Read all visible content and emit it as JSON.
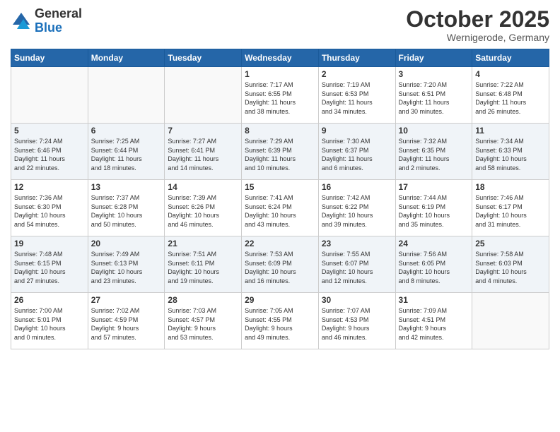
{
  "header": {
    "logo_general": "General",
    "logo_blue": "Blue",
    "month": "October 2025",
    "location": "Wernigerode, Germany"
  },
  "weekdays": [
    "Sunday",
    "Monday",
    "Tuesday",
    "Wednesday",
    "Thursday",
    "Friday",
    "Saturday"
  ],
  "weeks": [
    [
      {
        "day": "",
        "info": ""
      },
      {
        "day": "",
        "info": ""
      },
      {
        "day": "",
        "info": ""
      },
      {
        "day": "1",
        "info": "Sunrise: 7:17 AM\nSunset: 6:55 PM\nDaylight: 11 hours\nand 38 minutes."
      },
      {
        "day": "2",
        "info": "Sunrise: 7:19 AM\nSunset: 6:53 PM\nDaylight: 11 hours\nand 34 minutes."
      },
      {
        "day": "3",
        "info": "Sunrise: 7:20 AM\nSunset: 6:51 PM\nDaylight: 11 hours\nand 30 minutes."
      },
      {
        "day": "4",
        "info": "Sunrise: 7:22 AM\nSunset: 6:48 PM\nDaylight: 11 hours\nand 26 minutes."
      }
    ],
    [
      {
        "day": "5",
        "info": "Sunrise: 7:24 AM\nSunset: 6:46 PM\nDaylight: 11 hours\nand 22 minutes."
      },
      {
        "day": "6",
        "info": "Sunrise: 7:25 AM\nSunset: 6:44 PM\nDaylight: 11 hours\nand 18 minutes."
      },
      {
        "day": "7",
        "info": "Sunrise: 7:27 AM\nSunset: 6:41 PM\nDaylight: 11 hours\nand 14 minutes."
      },
      {
        "day": "8",
        "info": "Sunrise: 7:29 AM\nSunset: 6:39 PM\nDaylight: 11 hours\nand 10 minutes."
      },
      {
        "day": "9",
        "info": "Sunrise: 7:30 AM\nSunset: 6:37 PM\nDaylight: 11 hours\nand 6 minutes."
      },
      {
        "day": "10",
        "info": "Sunrise: 7:32 AM\nSunset: 6:35 PM\nDaylight: 11 hours\nand 2 minutes."
      },
      {
        "day": "11",
        "info": "Sunrise: 7:34 AM\nSunset: 6:33 PM\nDaylight: 10 hours\nand 58 minutes."
      }
    ],
    [
      {
        "day": "12",
        "info": "Sunrise: 7:36 AM\nSunset: 6:30 PM\nDaylight: 10 hours\nand 54 minutes."
      },
      {
        "day": "13",
        "info": "Sunrise: 7:37 AM\nSunset: 6:28 PM\nDaylight: 10 hours\nand 50 minutes."
      },
      {
        "day": "14",
        "info": "Sunrise: 7:39 AM\nSunset: 6:26 PM\nDaylight: 10 hours\nand 46 minutes."
      },
      {
        "day": "15",
        "info": "Sunrise: 7:41 AM\nSunset: 6:24 PM\nDaylight: 10 hours\nand 43 minutes."
      },
      {
        "day": "16",
        "info": "Sunrise: 7:42 AM\nSunset: 6:22 PM\nDaylight: 10 hours\nand 39 minutes."
      },
      {
        "day": "17",
        "info": "Sunrise: 7:44 AM\nSunset: 6:19 PM\nDaylight: 10 hours\nand 35 minutes."
      },
      {
        "day": "18",
        "info": "Sunrise: 7:46 AM\nSunset: 6:17 PM\nDaylight: 10 hours\nand 31 minutes."
      }
    ],
    [
      {
        "day": "19",
        "info": "Sunrise: 7:48 AM\nSunset: 6:15 PM\nDaylight: 10 hours\nand 27 minutes."
      },
      {
        "day": "20",
        "info": "Sunrise: 7:49 AM\nSunset: 6:13 PM\nDaylight: 10 hours\nand 23 minutes."
      },
      {
        "day": "21",
        "info": "Sunrise: 7:51 AM\nSunset: 6:11 PM\nDaylight: 10 hours\nand 19 minutes."
      },
      {
        "day": "22",
        "info": "Sunrise: 7:53 AM\nSunset: 6:09 PM\nDaylight: 10 hours\nand 16 minutes."
      },
      {
        "day": "23",
        "info": "Sunrise: 7:55 AM\nSunset: 6:07 PM\nDaylight: 10 hours\nand 12 minutes."
      },
      {
        "day": "24",
        "info": "Sunrise: 7:56 AM\nSunset: 6:05 PM\nDaylight: 10 hours\nand 8 minutes."
      },
      {
        "day": "25",
        "info": "Sunrise: 7:58 AM\nSunset: 6:03 PM\nDaylight: 10 hours\nand 4 minutes."
      }
    ],
    [
      {
        "day": "26",
        "info": "Sunrise: 7:00 AM\nSunset: 5:01 PM\nDaylight: 10 hours\nand 0 minutes."
      },
      {
        "day": "27",
        "info": "Sunrise: 7:02 AM\nSunset: 4:59 PM\nDaylight: 9 hours\nand 57 minutes."
      },
      {
        "day": "28",
        "info": "Sunrise: 7:03 AM\nSunset: 4:57 PM\nDaylight: 9 hours\nand 53 minutes."
      },
      {
        "day": "29",
        "info": "Sunrise: 7:05 AM\nSunset: 4:55 PM\nDaylight: 9 hours\nand 49 minutes."
      },
      {
        "day": "30",
        "info": "Sunrise: 7:07 AM\nSunset: 4:53 PM\nDaylight: 9 hours\nand 46 minutes."
      },
      {
        "day": "31",
        "info": "Sunrise: 7:09 AM\nSunset: 4:51 PM\nDaylight: 9 hours\nand 42 minutes."
      },
      {
        "day": "",
        "info": ""
      }
    ]
  ]
}
